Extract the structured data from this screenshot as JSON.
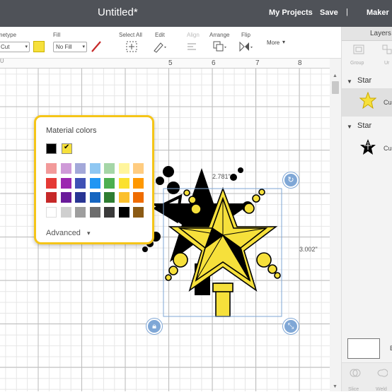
{
  "header": {
    "title": "Untitled*",
    "my_projects": "My Projects",
    "save": "Save",
    "separator": "|",
    "maker": "Maker"
  },
  "toolbar": {
    "linetype_label": "netype",
    "linetype_value": "Cut",
    "fill_label": "Fill",
    "fill_value": "No Fill",
    "select_all": "Select All",
    "edit": "Edit",
    "align": "Align",
    "arrange": "Arrange",
    "flip": "Flip",
    "more": "More"
  },
  "ruler": {
    "ticks": [
      "5",
      "6",
      "7",
      "8"
    ]
  },
  "canvas": {
    "width_readout": "2.781\"",
    "height_readout": "3.002\"",
    "star_fill": "#f6e03b",
    "shadow_fill": "#000000"
  },
  "material_popup": {
    "title": "Material colors",
    "recent": [
      {
        "color": "#000000",
        "selected": false
      },
      {
        "color": "#f6e03b",
        "selected": true
      }
    ],
    "palette": [
      [
        "#f29a9a",
        "#cf9ad8",
        "#a3a8d9",
        "#8fc7f2",
        "#a5d6a7",
        "#fff59d",
        "#ffcc80"
      ],
      [
        "#e53935",
        "#9c27b0",
        "#3f51b5",
        "#2196f3",
        "#4caf50",
        "#fbe12e",
        "#ff9800"
      ],
      [
        "#c62828",
        "#6a1b9a",
        "#283593",
        "#1565c0",
        "#2e7d32",
        "#fbc02d",
        "#ef6c00"
      ],
      [
        "#ffffff",
        "#cfcfcf",
        "#9e9e9e",
        "#6d6d6d",
        "#3a3a3a",
        "#000000",
        "#8b5a14"
      ]
    ],
    "advanced": "Advanced"
  },
  "layers_panel": {
    "title": "Layers",
    "tools": [
      "Group",
      "Ur"
    ],
    "groups": [
      {
        "name": "Star",
        "item_label": "Cu",
        "icon": "yellow-star-thumbnail"
      },
      {
        "name": "Star",
        "item_label": "Cu",
        "icon": "black-star-thumbnail"
      }
    ],
    "bottom_tools": [
      "Slice",
      "Weld"
    ],
    "bottom_letter": "B"
  }
}
